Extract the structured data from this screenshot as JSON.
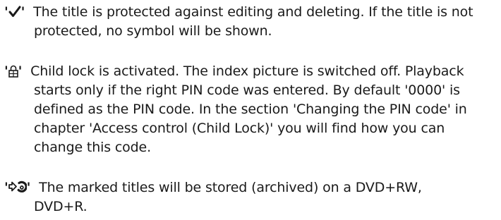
{
  "entries": [
    {
      "symbol": "check-mark",
      "lines": [
        "The title is protected against editing and deleting. If the title is not",
        "protected, no symbol will be shown."
      ]
    },
    {
      "symbol": "padlock",
      "lines": [
        "Child lock is activated. The index picture is switched off. Playback",
        "starts only if the right PIN code was entered. By default '0000' is",
        "defined as the PIN code. In the section 'Changing the PIN code' in",
        "chapter 'Access control (Child Lock)' you will find how you can",
        "change this code."
      ]
    },
    {
      "symbol": "archive-disc",
      "lines": [
        "The marked titles will be stored (archived) on a DVD+RW,",
        "DVD+R."
      ]
    }
  ],
  "quote": "'"
}
